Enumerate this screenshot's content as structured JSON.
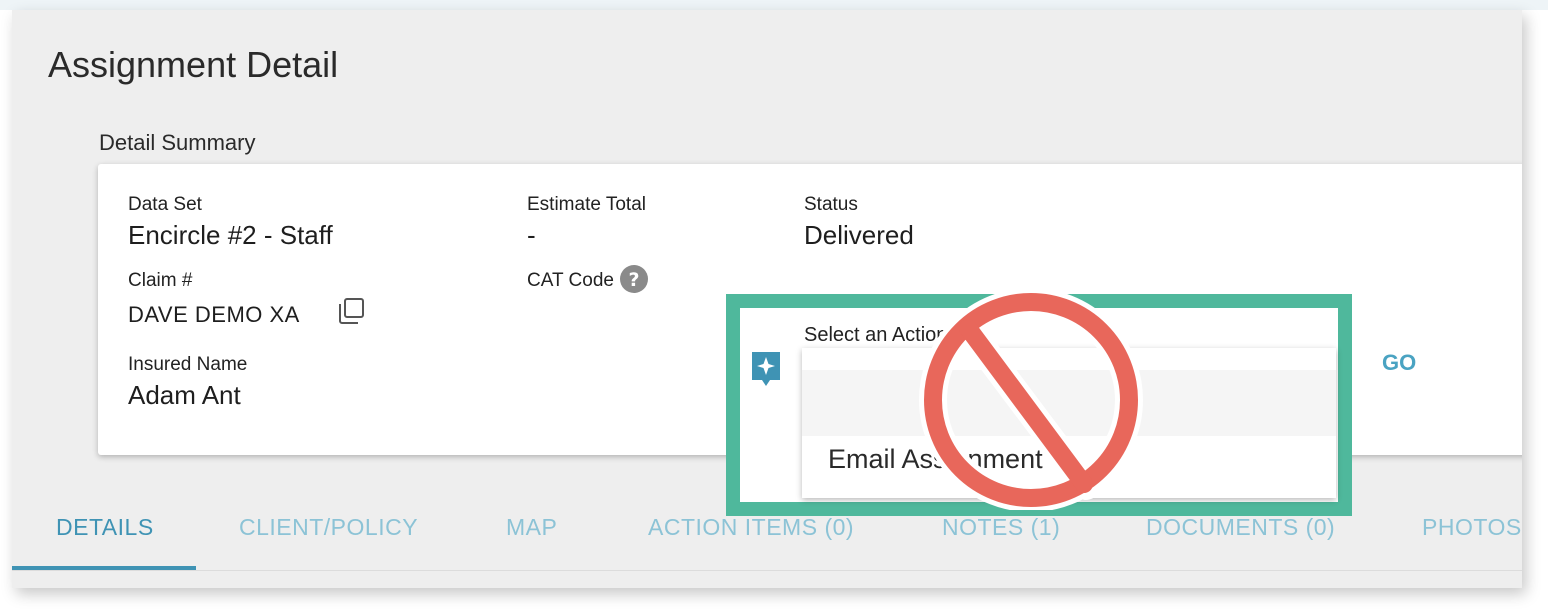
{
  "page": {
    "title": "Assignment Detail",
    "section_title": "Detail Summary"
  },
  "summary": {
    "data_set": {
      "label": "Data Set",
      "value": "Encircle #2 - Staff"
    },
    "estimate_total": {
      "label": "Estimate Total",
      "value": "-"
    },
    "status": {
      "label": "Status",
      "value": "Delivered"
    },
    "claim": {
      "label": "Claim #",
      "value": "DAVE DEMO XA",
      "icon": "copy-icon"
    },
    "cat_code": {
      "label": "CAT Code",
      "icon": "help-icon"
    },
    "insured_name": {
      "label": "Insured Name",
      "value": "Adam Ant"
    }
  },
  "action": {
    "label": "Select an Action",
    "options": [
      "",
      "Email Assignment"
    ],
    "go_label": "GO",
    "icon": "sparkle-icon"
  },
  "overlay": {
    "icon": "prohibited-icon"
  },
  "tabs": [
    {
      "label": "DETAILS",
      "active": true
    },
    {
      "label": "CLIENT/POLICY",
      "active": false
    },
    {
      "label": "MAP",
      "active": false
    },
    {
      "label": "ACTION ITEMS (0)",
      "active": false
    },
    {
      "label": "NOTES (1)",
      "active": false
    },
    {
      "label": "DOCUMENTS (0)",
      "active": false
    },
    {
      "label": "PHOTOS",
      "active": false
    }
  ],
  "colors": {
    "accent": "#3f93b4",
    "tab_inactive": "#8cc3d6",
    "highlight_border": "#4fb89c",
    "prohibited": "#e8675b",
    "background": "#eeeeee"
  }
}
